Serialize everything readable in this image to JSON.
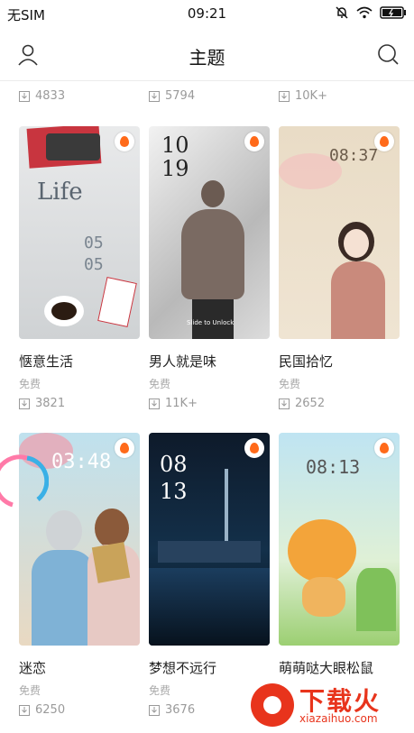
{
  "status_bar": {
    "carrier": "无SIM",
    "time": "09:21"
  },
  "header": {
    "title": "主题"
  },
  "previous_row_counts": [
    "4833",
    "5794",
    "10K+"
  ],
  "themes": [
    {
      "name": "惬意生活",
      "price": "免费",
      "downloads": "3821",
      "preview_text": "Life",
      "preview_clock": "05 05"
    },
    {
      "name": "男人就是味",
      "price": "免费",
      "downloads": "11K+",
      "preview_clock": "10 19",
      "preview_hint": "Slide to Unlock"
    },
    {
      "name": "民国拾忆",
      "price": "免费",
      "downloads": "2652",
      "preview_clock": "08:37"
    },
    {
      "name": "迷恋",
      "price": "免费",
      "downloads": "6250",
      "preview_clock": "03:48"
    },
    {
      "name": "梦想不远行",
      "price": "免费",
      "downloads": "3676",
      "preview_clock": "08 13"
    },
    {
      "name": "萌萌哒大眼松鼠",
      "price": "",
      "downloads": "",
      "preview_clock": "08:13"
    }
  ],
  "watermark": {
    "brand": "下载火",
    "url": "xiazaihuo.com"
  }
}
